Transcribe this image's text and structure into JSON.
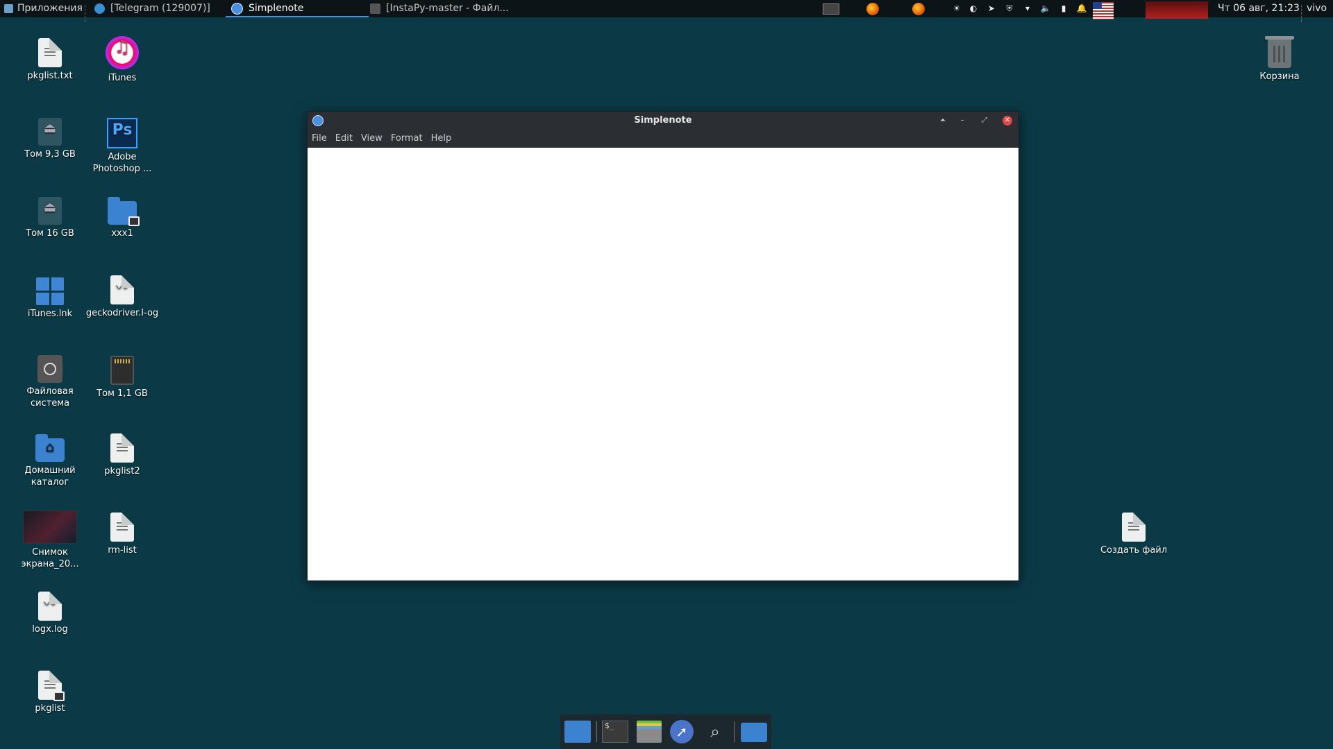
{
  "panel": {
    "apps_label": "Приложения",
    "tasks": [
      {
        "label": "[Telegram (129007)]"
      },
      {
        "label": "Simplenote"
      },
      {
        "label": "[InstaPy-master - Файл..."
      }
    ],
    "clock": "Чт 06 авг, 21:23",
    "user": "vivo"
  },
  "desktop": {
    "icons": [
      {
        "label": "pkglist.txt",
        "icon": "text-file-icon"
      },
      {
        "label": "iTunes",
        "icon": "itunes-icon"
      },
      {
        "label": "Том 9,3 GB",
        "icon": "drive-icon"
      },
      {
        "label": "Adobe Photoshop ...",
        "icon": "photoshop-icon"
      },
      {
        "label": "Том 16 GB",
        "icon": "drive-icon"
      },
      {
        "label": "xxx1",
        "icon": "locked-folder-icon"
      },
      {
        "label": "iTunes.lnk",
        "icon": "windows-shortcut-icon"
      },
      {
        "label": "geckodriver.l-og",
        "icon": "log-file-icon"
      },
      {
        "label": "Файловая система",
        "icon": "filesystem-icon"
      },
      {
        "label": "Том 1,1 GB",
        "icon": "sd-card-icon"
      },
      {
        "label": "Домашний каталог",
        "icon": "home-folder-icon"
      },
      {
        "label": "pkglist2",
        "icon": "text-file-icon"
      },
      {
        "label": "Снимок экрана_20...",
        "icon": "screenshot-thumbnail"
      },
      {
        "label": "rm-list",
        "icon": "text-file-icon"
      },
      {
        "label": "logx.log",
        "icon": "log-file-icon"
      },
      {
        "label": "pkglist",
        "icon": "locked-text-file-icon"
      },
      {
        "label": "Корзина",
        "icon": "trash-icon"
      },
      {
        "label": "Создать файл",
        "icon": "text-file-icon"
      }
    ]
  },
  "window": {
    "title": "Simplenote",
    "menu": [
      "File",
      "Edit",
      "View",
      "Format",
      "Help"
    ]
  },
  "dock": {
    "items": [
      "show-desktop-icon",
      "terminal-icon",
      "file-manager-icon",
      "browser-icon",
      "search-icon",
      "folder-icon"
    ]
  }
}
